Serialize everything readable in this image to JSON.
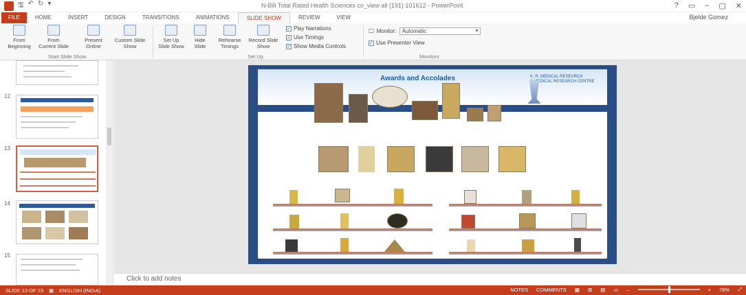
{
  "title_bar": {
    "title": "N-Bill Total Rated Health Sciences co_view all (191) 101612 - PowerPoint",
    "qat_save": "🖫",
    "qat_undo": "↶",
    "qat_redo": "↻",
    "qat_more": "▾",
    "help": "?",
    "ribbon_opts": "▭",
    "minimize": "–",
    "maximize": "▢",
    "close": "✕",
    "user": "Bjelde Gomez"
  },
  "tabs": [
    "FILE",
    "HOME",
    "INSERT",
    "DESIGN",
    "TRANSITIONS",
    "ANIMATIONS",
    "SLIDE SHOW",
    "REVIEW",
    "VIEW"
  ],
  "active_tab": "SLIDE SHOW",
  "ribbon": {
    "from_beginning": "From\nBeginning",
    "from_current": "From\nCurrent Slide",
    "present_online": "Present\nOnline",
    "custom_show": "Custom Slide\nShow",
    "group_start": "Start Slide Show",
    "setup_show": "Set Up\nSlide Show",
    "hide_slide": "Hide\nSlide",
    "rehearse": "Rehearse\nTimings",
    "record": "Record Slide\nShow",
    "group_setup": "Set Up",
    "play_narrations": "Play Narrations",
    "use_timings": "Use Timings",
    "show_media": "Show Media Controls",
    "monitor_label": "Monitor:",
    "monitor_value": "Automatic",
    "use_presenter": "Use Presenter View",
    "group_monitors": "Monitors"
  },
  "thumbnails": [
    {
      "num": "12"
    },
    {
      "num": "13"
    },
    {
      "num": "14"
    },
    {
      "num": "15"
    }
  ],
  "slide": {
    "title": "Awards and Accolades",
    "brand_line1": "K. R. MEDICAL RESEARCH",
    "brand_line2": "& MEDICAL RESEARCH CENTRE"
  },
  "notes_placeholder": "Click to add notes",
  "status": {
    "slide_info": "SLIDE 13 OF 23",
    "language": "ENGLISH (INDIA)",
    "notes_btn": "NOTES",
    "comments_btn": "COMMENTS",
    "zoom": "78%"
  }
}
